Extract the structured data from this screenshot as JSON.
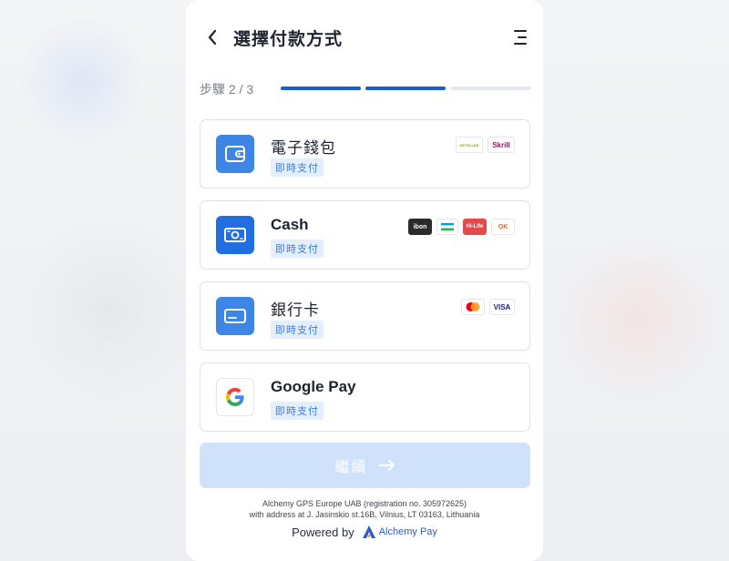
{
  "header": {
    "title": "選擇付款方式"
  },
  "steps": {
    "label": "步驟 2 / 3",
    "current": 2,
    "total": 3,
    "active_color": "#1f5fb8",
    "inactive_color": "#e3e8ef"
  },
  "methods": [
    {
      "title": "電子錢包",
      "tag": "即時支付",
      "icon": "wallet-icon",
      "logos": [
        "NETELLER",
        "Skrill"
      ]
    },
    {
      "title": "Cash",
      "tag": "即時支付",
      "icon": "cash-icon",
      "logos": [
        "ibon",
        "FamilyMart",
        "Hi-Life",
        "OK"
      ]
    },
    {
      "title": "銀行卡",
      "tag": "即時支付",
      "icon": "card-icon",
      "logos": [
        "mastercard",
        "VISA"
      ]
    },
    {
      "title": "Google Pay",
      "tag": "即時支付",
      "icon": "google-icon",
      "logos": []
    }
  ],
  "continue_button": {
    "label": "繼續"
  },
  "footer": {
    "line1": "Alchemy GPS Europe UAB (registration no. 305972625)",
    "line2": "with address at J. Jasinskio st.16B, Vilnius, LT 03163, Lithuania",
    "powered_by": "Powered by",
    "brand": "Alchemy Pay"
  },
  "colors": {
    "accent": "#3d86e6",
    "tag_bg": "#e3efff",
    "tag_text": "#3b7de0",
    "button_disabled": "#cfe1fb"
  }
}
